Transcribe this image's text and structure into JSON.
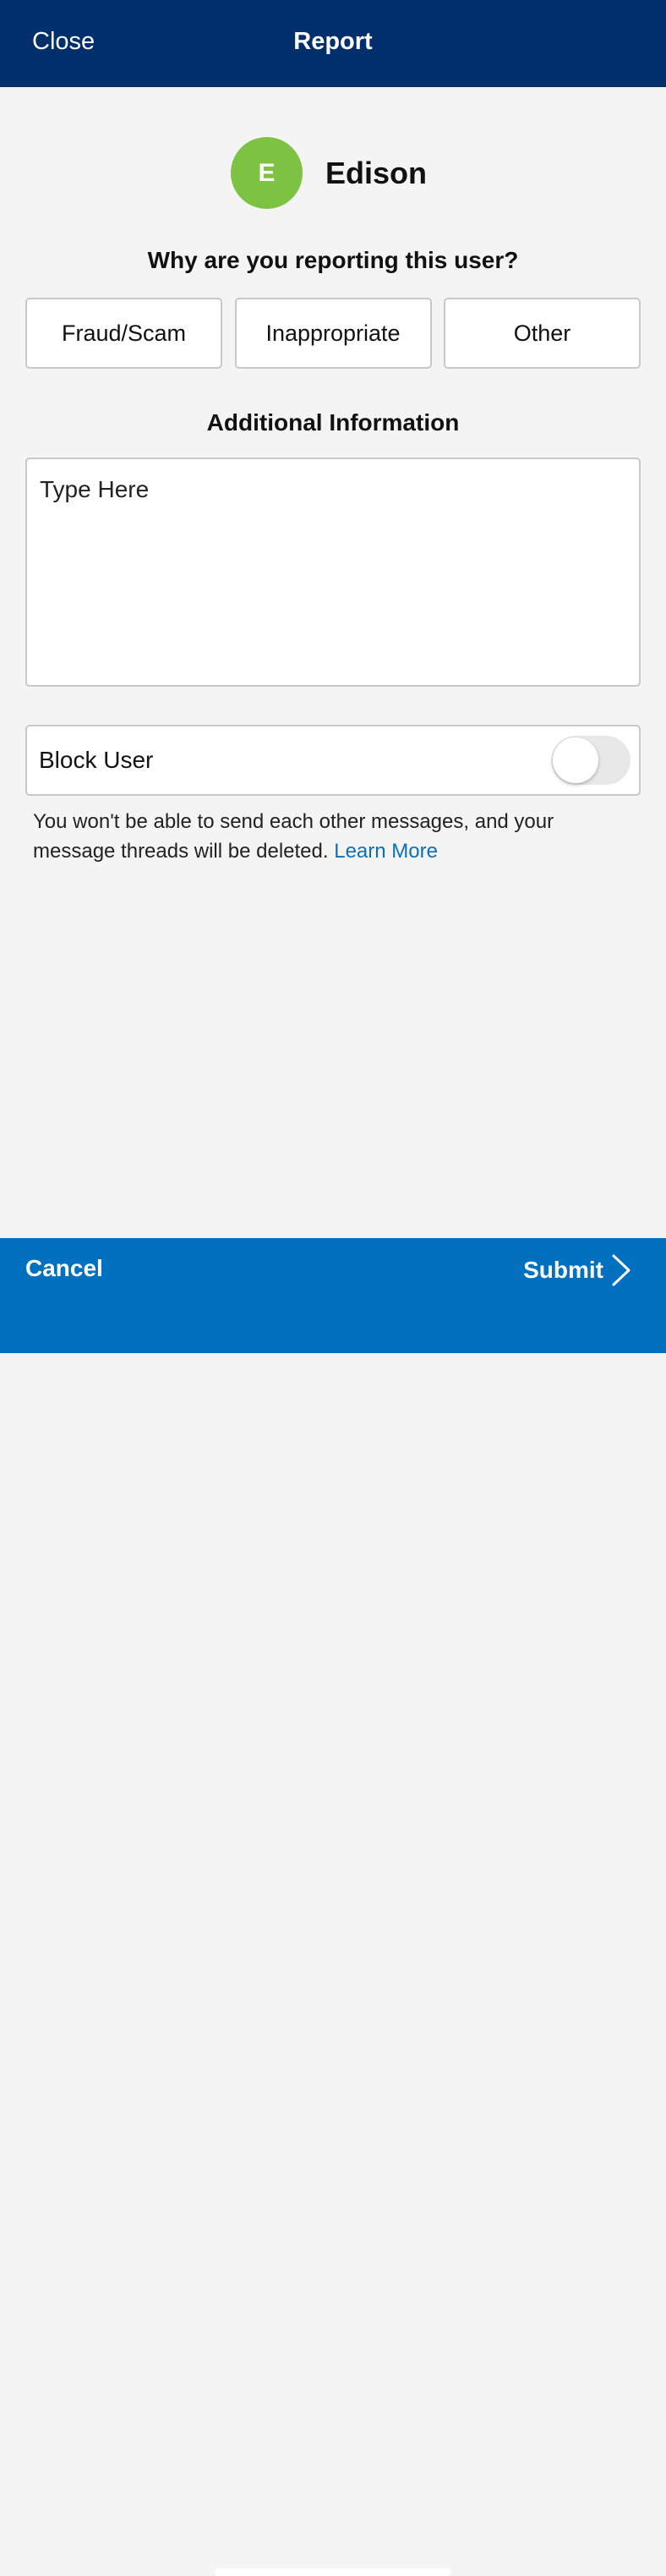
{
  "header": {
    "close_label": "Close",
    "title": "Report"
  },
  "user": {
    "initial": "E",
    "name": "Edison",
    "avatar_color": "#7dc242"
  },
  "question": "Why are you reporting this user?",
  "reasons": [
    {
      "label": "Fraud/Scam"
    },
    {
      "label": "Inappropriate"
    },
    {
      "label": "Other"
    }
  ],
  "additional": {
    "heading": "Additional Information",
    "placeholder": "Type Here",
    "value": ""
  },
  "block": {
    "label": "Block User",
    "enabled": false,
    "note": "You won't be able to send each other messages, and your message threads will be deleted.",
    "learn_more": "Learn More"
  },
  "footer": {
    "cancel_label": "Cancel",
    "submit_label": "Submit"
  },
  "colors": {
    "header_bg": "#002f6c",
    "footer_bg": "#0070bf",
    "link": "#0b6fbd",
    "page_bg": "#f4f4f4"
  },
  "icons": {
    "submit": "chevron-right-icon"
  }
}
